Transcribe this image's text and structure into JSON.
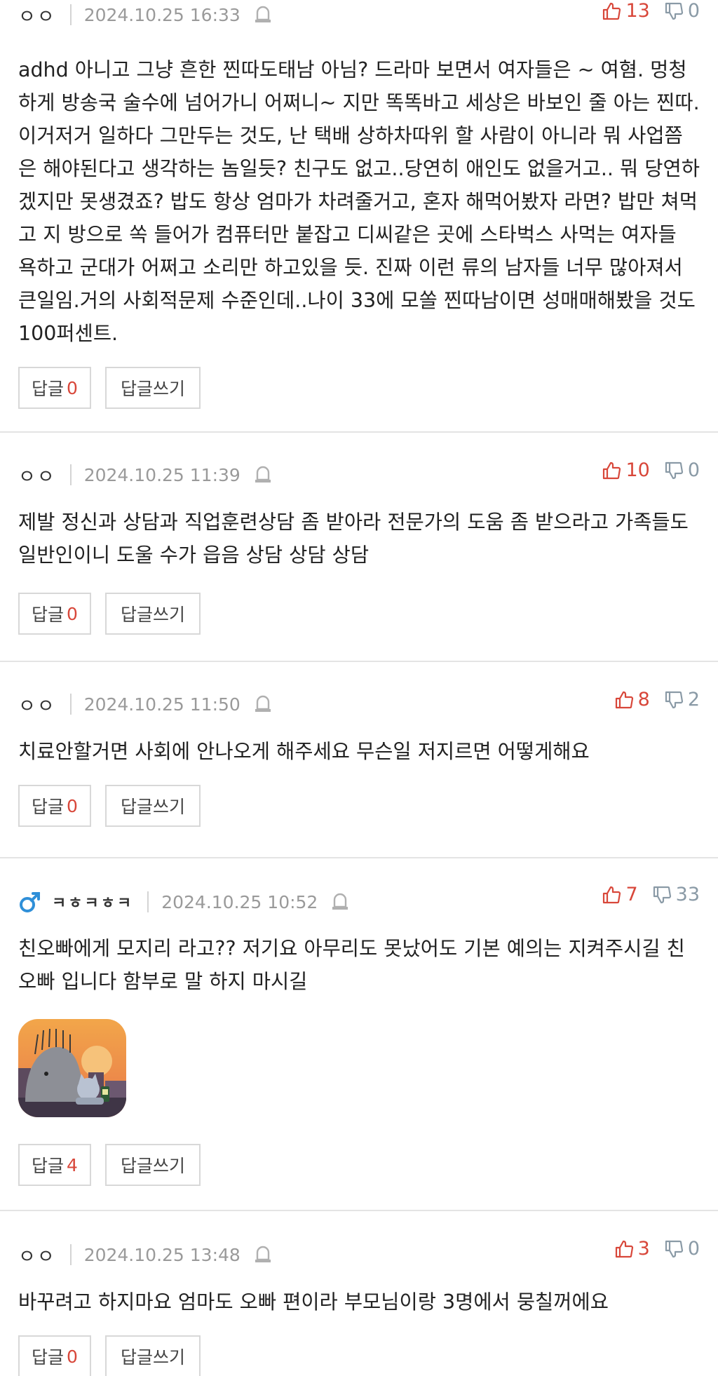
{
  "comments": [
    {
      "nickname": "ㅇㅇ",
      "date": "2024.10.25 16:33",
      "likes": "13",
      "dislikes": "0",
      "text": "adhd 아니고 그냥 흔한 찐따도태남 아님? 드라마 보면서 여자들은 ~ 여혐. 멍청하게 방송국 술수에 넘어가니 어쩌니~ 지만 똑똑바고 세상은 바보인 줄 아는 찐따. 이거저거 일하다 그만두는 것도, 난 택배 상하차따위 할 사람이 아니라 뭐 사업쯤은 해야된다고 생각하는 놈일듯? 친구도 없고..당연히 애인도 없을거고.. 뭐 당연하겠지만 못생겼죠? 밥도 항상 엄마가 차려줄거고, 혼자 해먹어봤자 라면? 밥만 쳐먹고 지 방으로 쏙 들어가 컴퓨터만 붙잡고 디씨같은 곳에 스타벅스 사먹는 여자들 욕하고 군대가 어쩌고 소리만 하고있을 듯. 진짜 이런 류의 남자들 너무 많아져서 큰일임.거의 사회적문제 수준인데..나이 33에 모쏠 찐따남이면 성매매해봤을 것도 100퍼센트.",
      "reply_label": "답글",
      "reply_count": "0",
      "write_label": "답글쓰기"
    },
    {
      "nickname": "ㅇㅇ",
      "date": "2024.10.25 11:39",
      "likes": "10",
      "dislikes": "0",
      "text": "제발 정신과 상담과 직업훈련상담 좀 받아라 전문가의 도움 좀 받으라고 가족들도 일반인이니 도울 수가 읍음 상담 상담 상담",
      "reply_label": "답글",
      "reply_count": "0",
      "write_label": "답글쓰기"
    },
    {
      "nickname": "ㅇㅇ",
      "date": "2024.10.25 11:50",
      "likes": "8",
      "dislikes": "2",
      "text": "치료안할거면 사회에 안나오게 해주세요 무슨일 저지르면 어떻게해요",
      "reply_label": "답글",
      "reply_count": "0",
      "write_label": "답글쓰기"
    },
    {
      "nickname": "ㅋㅎㅋㅎㅋ",
      "date": "2024.10.25 10:52",
      "likes": "7",
      "dislikes": "33",
      "text": "친오빠에게 모지리 라고?? 저기요 아무리도 못났어도 기본 예의는 지켜주시길 친오빠 입니다 함부로 말 하지 마시길",
      "reply_label": "답글",
      "reply_count": "4",
      "write_label": "답글쓰기"
    },
    {
      "nickname": "ㅇㅇ",
      "date": "2024.10.25 13:48",
      "likes": "3",
      "dislikes": "0",
      "text": "바꾸려고 하지마요 엄마도 오빠 편이라 부모님이랑 3명에서 뭉칠꺼에요",
      "reply_label": "답글",
      "reply_count": "0",
      "write_label": "답글쓰기"
    }
  ],
  "colors": {
    "like": "#d8473a",
    "dislike": "#8a9aa6",
    "date": "#9a9a9a",
    "male_icon": "#2f8fd8",
    "divider": "#e4e4e4"
  },
  "icons": {
    "report": "report-bell-icon",
    "like": "thumbs-up-icon",
    "dislike": "thumbs-down-icon",
    "gender": "male-symbol-icon"
  }
}
